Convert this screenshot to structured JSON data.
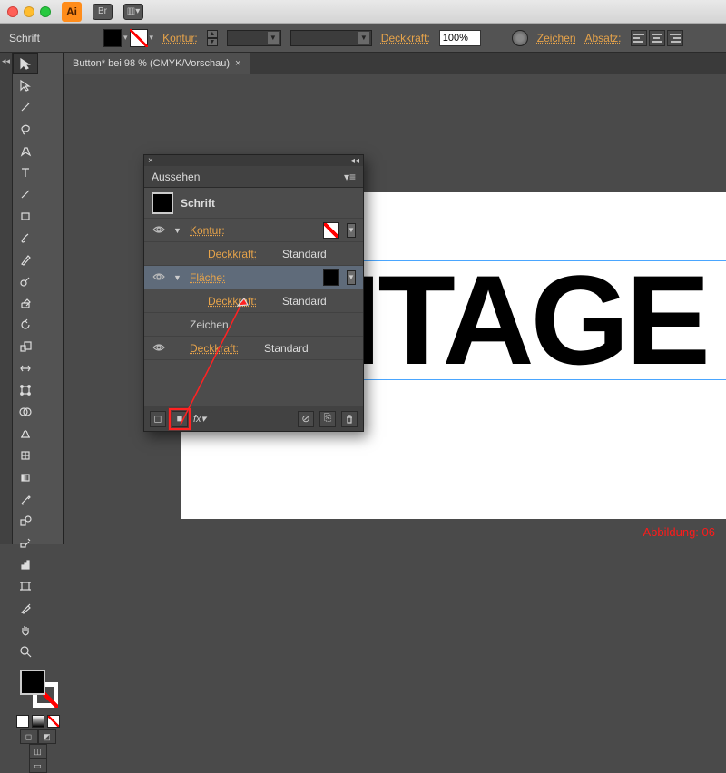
{
  "app": {
    "icon_label": "Ai",
    "br_btn": "Br"
  },
  "optbar": {
    "mode_label": "Schrift",
    "kontur_label": "Kontur:",
    "deckkraft_label": "Deckkraft:",
    "opacity_value": "100%",
    "zeichen_label": "Zeichen",
    "absatz_label": "Absatz:"
  },
  "doc": {
    "tab_label": "Button* bei 98 % (CMYK/Vorschau)",
    "close": "×",
    "big_text": "VINTAGE",
    "caption": "Abbildung: 06"
  },
  "panel": {
    "collapse": "◂◂",
    "close": "×",
    "title": "Aussehen",
    "menu": "▾≡",
    "obj_type": "Schrift",
    "rows": {
      "kontur_label": "Kontur:",
      "deckkraft_label": "Deckkraft:",
      "deckkraft_value": "Standard",
      "flaeche_label": "Fläche:",
      "zeichen_label": "Zeichen"
    },
    "foot": {
      "nostroke_title": "⊘",
      "dup_title": "⎘",
      "trash_title": "🗑",
      "fx_label": "fx▾"
    }
  },
  "collapse_strip": "◂◂",
  "colors": {
    "accent": "#e8a44a",
    "highlight": "#ff2222"
  }
}
